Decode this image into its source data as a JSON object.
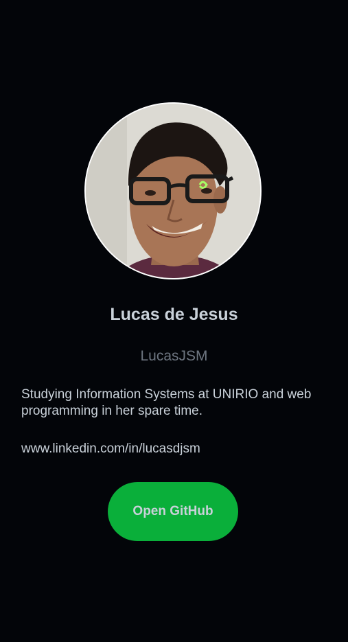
{
  "profile": {
    "name": "Lucas de Jesus",
    "username": "LucasJSM",
    "bio": "Studying Information Systems at UNIRIO and web programming in her spare time.",
    "blog": "www.linkedin.com/in/lucasdjsm"
  },
  "actions": {
    "open_github_label": "Open GitHub"
  },
  "colors": {
    "background": "#030509",
    "text": "#c9d1d9",
    "muted": "#6e7681",
    "button": "#0aaf3a"
  }
}
